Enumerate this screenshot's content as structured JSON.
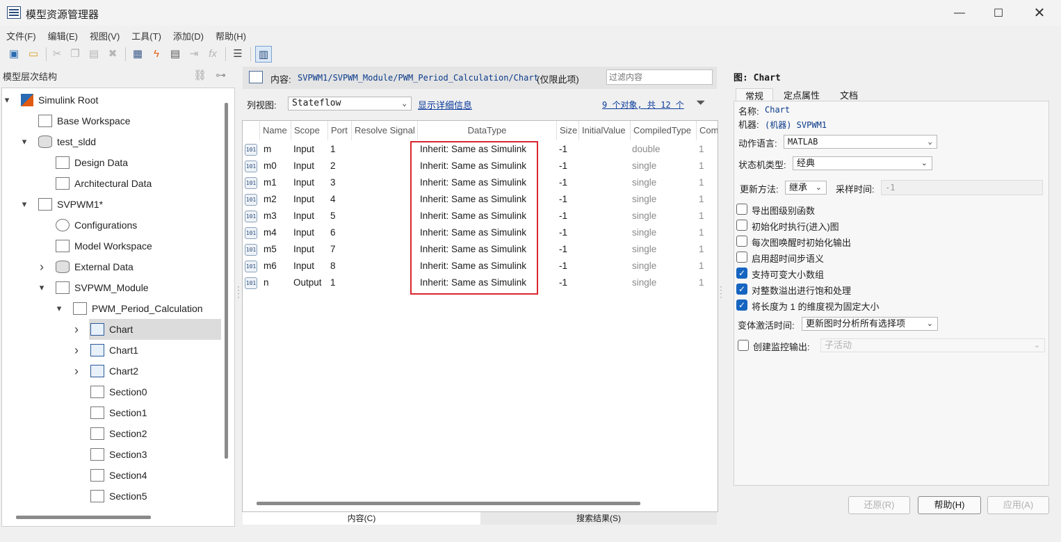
{
  "window": {
    "title": "模型资源管理器"
  },
  "menu": [
    "文件(F)",
    "编辑(E)",
    "视图(V)",
    "工具(T)",
    "添加(D)",
    "帮助(H)"
  ],
  "left": {
    "header": "模型层次结构",
    "tree": [
      {
        "label": "Simulink Root",
        "expander": "▾",
        "icon": "simulink-root-icon"
      },
      {
        "label": "Base Workspace",
        "expander": "",
        "icon": "workspace-icon"
      },
      {
        "label": "test_sldd",
        "expander": "▾",
        "icon": "dictionary-icon"
      },
      {
        "label": "Design Data",
        "expander": "",
        "icon": "design-data-icon"
      },
      {
        "label": "Architectural Data",
        "expander": "",
        "icon": "architectural-data-icon"
      },
      {
        "label": "SVPWM1*",
        "expander": "▾",
        "icon": "model-icon"
      },
      {
        "label": "Configurations",
        "expander": "",
        "icon": "gear-icon"
      },
      {
        "label": "Model Workspace",
        "expander": "",
        "icon": "workspace-icon"
      },
      {
        "label": "External Data",
        "expander": "›",
        "icon": "dictionary-icon"
      },
      {
        "label": "SVPWM_Module",
        "expander": "▾",
        "icon": "subsystem-icon"
      },
      {
        "label": "PWM_Period_Calculation",
        "expander": "▾",
        "icon": "subsystem-icon"
      },
      {
        "label": "Chart",
        "expander": "›",
        "icon": "chart-icon"
      },
      {
        "label": "Chart1",
        "expander": "›",
        "icon": "chart-icon"
      },
      {
        "label": "Chart2",
        "expander": "›",
        "icon": "chart-icon"
      },
      {
        "label": "Section0",
        "expander": "",
        "icon": "subsystem-icon"
      },
      {
        "label": "Section1",
        "expander": "",
        "icon": "subsystem-icon"
      },
      {
        "label": "Section2",
        "expander": "",
        "icon": "subsystem-icon"
      },
      {
        "label": "Section3",
        "expander": "",
        "icon": "subsystem-icon"
      },
      {
        "label": "Section4",
        "expander": "",
        "icon": "subsystem-icon"
      },
      {
        "label": "Section5",
        "expander": "",
        "icon": "subsystem-icon"
      }
    ]
  },
  "content": {
    "label": "内容:",
    "path": "SVPWM1/SVPWM_Module/PWM_Period_Calculation/Chart",
    "scope_note": "(仅限此项)",
    "filter_placeholder": "过滤内容",
    "column_view_label": "列视图:",
    "column_view_value": "Stateflow",
    "show_details": "显示详细信息",
    "count": "9 个对象, 共 12 个",
    "columns": [
      "Name",
      "Scope",
      "Port",
      "Resolve Signal",
      "DataType",
      "Size",
      "InitialValue",
      "CompiledType",
      "Com"
    ],
    "rows": [
      {
        "name": "m",
        "scope": "Input",
        "port": "1",
        "datatype": "Inherit: Same as Simulink",
        "size": "-1",
        "compiled": "double",
        "com": "1"
      },
      {
        "name": "m0",
        "scope": "Input",
        "port": "2",
        "datatype": "Inherit: Same as Simulink",
        "size": "-1",
        "compiled": "single",
        "com": "1"
      },
      {
        "name": "m1",
        "scope": "Input",
        "port": "3",
        "datatype": "Inherit: Same as Simulink",
        "size": "-1",
        "compiled": "single",
        "com": "1"
      },
      {
        "name": "m2",
        "scope": "Input",
        "port": "4",
        "datatype": "Inherit: Same as Simulink",
        "size": "-1",
        "compiled": "single",
        "com": "1"
      },
      {
        "name": "m3",
        "scope": "Input",
        "port": "5",
        "datatype": "Inherit: Same as Simulink",
        "size": "-1",
        "compiled": "single",
        "com": "1"
      },
      {
        "name": "m4",
        "scope": "Input",
        "port": "6",
        "datatype": "Inherit: Same as Simulink",
        "size": "-1",
        "compiled": "single",
        "com": "1"
      },
      {
        "name": "m5",
        "scope": "Input",
        "port": "7",
        "datatype": "Inherit: Same as Simulink",
        "size": "-1",
        "compiled": "single",
        "com": "1"
      },
      {
        "name": "m6",
        "scope": "Input",
        "port": "8",
        "datatype": "Inherit: Same as Simulink",
        "size": "-1",
        "compiled": "single",
        "com": "1"
      },
      {
        "name": "n",
        "scope": "Output",
        "port": "1",
        "datatype": "Inherit: Same as Simulink",
        "size": "-1",
        "compiled": "single",
        "com": "1"
      }
    ],
    "bottom_tabs": [
      "内容(C)",
      "搜索结果(S)"
    ]
  },
  "props": {
    "title_label": "图:",
    "title_value": "Chart",
    "tabs": [
      "常规",
      "定点属性",
      "文档"
    ],
    "name_label": "名称:",
    "name_value": "Chart",
    "machine_label": "机器:",
    "machine_value": "(机器) SVPWM1",
    "action_lang_label": "动作语言:",
    "action_lang_value": "MATLAB",
    "chart_type_label": "状态机类型:",
    "chart_type_value": "经典",
    "update_label": "更新方法:",
    "update_value": "继承",
    "sample_label": "采样时间:",
    "sample_value": "-1",
    "checks": [
      {
        "label": "导出图级别函数",
        "checked": false
      },
      {
        "label": "初始化时执行(进入)图",
        "checked": false
      },
      {
        "label": "每次图唤醒时初始化输出",
        "checked": false
      },
      {
        "label": "启用超时间步语义",
        "checked": false
      },
      {
        "label": "支持可变大小数组",
        "checked": true
      },
      {
        "label": "对整数溢出进行饱和处理",
        "checked": true
      },
      {
        "label": "将长度为 1 的维度视为固定大小",
        "checked": true
      }
    ],
    "variant_label": "变体激活时间:",
    "variant_value": "更新图时分析所有选择项",
    "monitor_label": "创建监控输出:",
    "monitor_value": "子活动",
    "buttons": [
      "还原(R)",
      "帮助(H)",
      "应用(A)"
    ]
  }
}
